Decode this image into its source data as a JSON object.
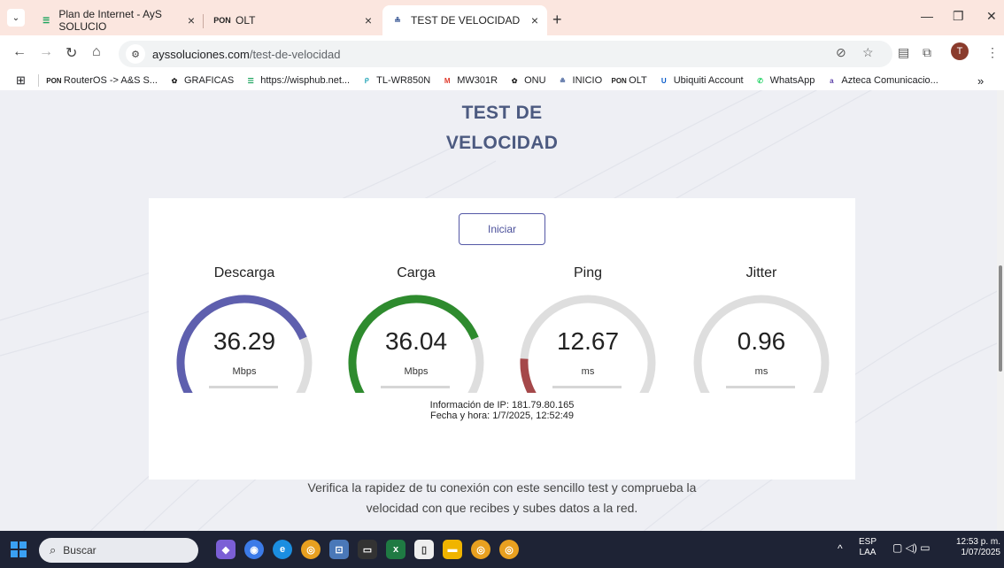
{
  "browser": {
    "tabs": [
      {
        "title": "Plan de Internet - AyS SOLUCIO",
        "icon": "wisphub-icon",
        "active": false
      },
      {
        "title": "OLT",
        "icon": "pon-icon",
        "active": false
      },
      {
        "title": "TEST DE VELOCIDAD",
        "icon": "speedtest-icon",
        "active": true
      }
    ],
    "new_tab": "+",
    "url_host": "ayssoluciones.com",
    "url_path": "/test-de-velocidad",
    "profile_initial": "T",
    "bookmarks": [
      {
        "label": "RouterOS -> A&S S...",
        "icon": "pon-icon",
        "color": "#222"
      },
      {
        "label": "GRAFICAS",
        "icon": "openai-icon",
        "color": "#222"
      },
      {
        "label": "https://wisphub.net...",
        "icon": "wisphub-icon",
        "color": "#1aa35c"
      },
      {
        "label": "TL-WR850N",
        "icon": "tplink-icon",
        "color": "#26a6b8"
      },
      {
        "label": "MW301R",
        "icon": "mercusys-icon",
        "color": "#e03b2d"
      },
      {
        "label": "ONU",
        "icon": "openai-icon",
        "color": "#222"
      },
      {
        "label": "INICIO",
        "icon": "speedtest-icon",
        "color": "#2a4b8d"
      },
      {
        "label": "OLT",
        "icon": "pon-icon",
        "color": "#222"
      },
      {
        "label": "Ubiquiti Account",
        "icon": "ubiquiti-icon",
        "color": "#0559c9"
      },
      {
        "label": "WhatsApp",
        "icon": "whatsapp-icon",
        "color": "#25d366"
      },
      {
        "label": "Azteca Comunicacio...",
        "icon": "azteca-icon",
        "color": "#5b3fa8"
      }
    ],
    "more_bookmarks": "»"
  },
  "page": {
    "title_line1": "TEST DE",
    "title_line2": "VELOCIDAD",
    "start_button": "Iniciar",
    "gauges": [
      {
        "label": "Descarga",
        "value": "36.29",
        "unit": "Mbps",
        "fill_fraction": 0.75,
        "color": "#5e5fae"
      },
      {
        "label": "Carga",
        "value": "36.04",
        "unit": "Mbps",
        "fill_fraction": 0.75,
        "color": "#2e8b2e"
      },
      {
        "label": "Ping",
        "value": "12.67",
        "unit": "ms",
        "fill_fraction": 0.18,
        "color": "#a5484a"
      },
      {
        "label": "Jitter",
        "value": "0.96",
        "unit": "ms",
        "fill_fraction": 0.05,
        "color": "#a5484a"
      }
    ],
    "ip_info": "Información de IP: 181.79.80.165",
    "datetime": "Fecha y hora: 1/7/2025, 12:52:49",
    "tagline_line1": "Verifica la rapidez de tu conexión con este sencillo test y comprueba la",
    "tagline_line2": "velocidad con que recibes y subes datos a la red."
  },
  "taskbar": {
    "search_placeholder": "Buscar",
    "lang": "ESP",
    "lang_sub": "LAA",
    "time": "12:53 p. m.",
    "date": "1/07/2025"
  }
}
